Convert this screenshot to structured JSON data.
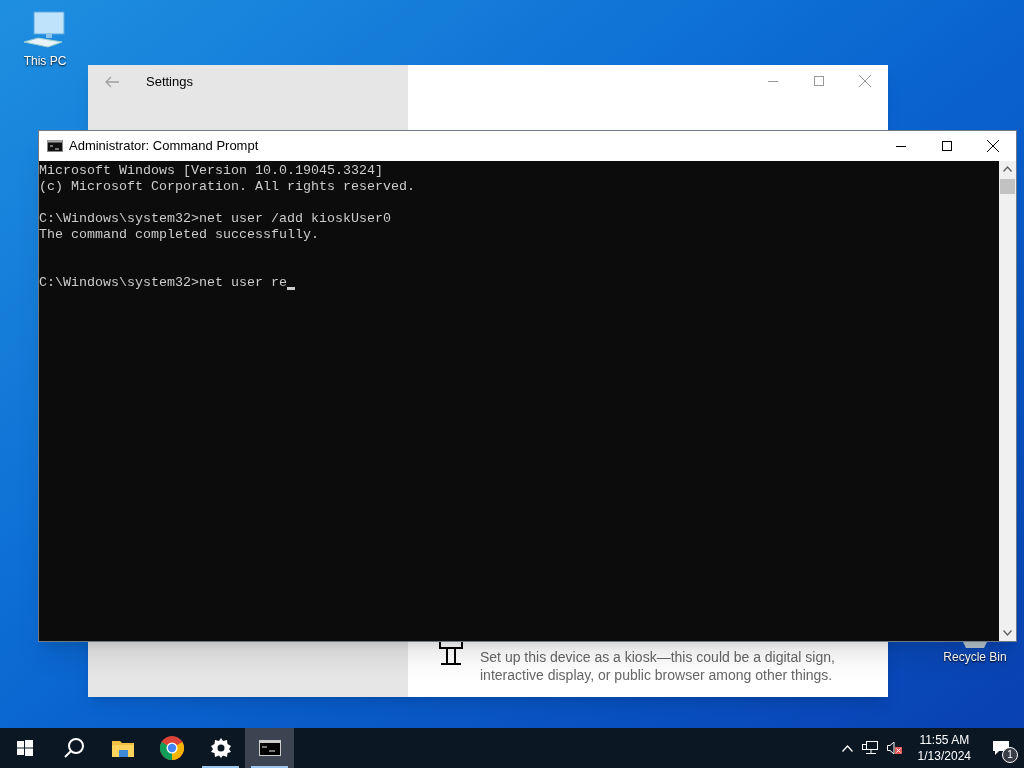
{
  "desktop_icons": [
    {
      "label": "This PC",
      "kind": "computer"
    },
    {
      "label": "Recycle Bin",
      "kind": "bin"
    }
  ],
  "settings_window": {
    "title": "Settings",
    "item": {
      "description": "Set up this device as a kiosk—this could be a digital sign, interactive display, or public browser among other things."
    }
  },
  "console_window": {
    "title": "Administrator: Command Prompt",
    "blocks": [
      {
        "lines": [
          "Microsoft Windows [Version 10.0.19045.3324]",
          "(c) Microsoft Corporation. All rights reserved."
        ],
        "extra_blank": false
      },
      {
        "lines": [
          "C:\\Windows\\system32>net user /add kioskUser0",
          "The command completed successfully."
        ],
        "extra_blank": true
      },
      {
        "lines": [
          "C:\\Windows\\system32>net user re"
        ],
        "extra_blank": false
      }
    ],
    "cursor": true
  },
  "taskbar": {
    "items": [
      {
        "kind": "start",
        "running": false,
        "selected": false
      },
      {
        "kind": "search",
        "running": false,
        "selected": false
      },
      {
        "kind": "folder",
        "running": false,
        "selected": false
      },
      {
        "kind": "browser",
        "running": false,
        "selected": false
      },
      {
        "kind": "settings",
        "running": true,
        "selected": false
      },
      {
        "kind": "console",
        "running": true,
        "selected": true
      }
    ],
    "time": "11:55 AM",
    "date": "1/13/2024",
    "notification_count": "1"
  }
}
